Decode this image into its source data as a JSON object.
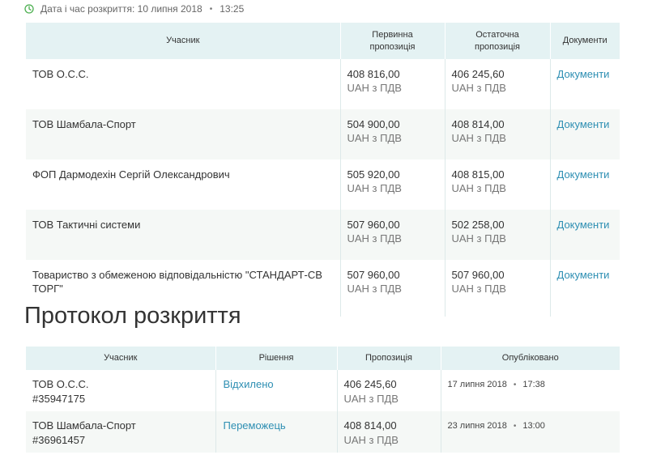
{
  "opening": {
    "label": "Дата і час розкриття: 10 липня 2018",
    "separator": "•",
    "time": "13:25"
  },
  "bids": {
    "headers": {
      "participant": "Учасник",
      "initial_line1": "Первинна",
      "initial_line2": "пропозиція",
      "final_line1": "Остаточна",
      "final_line2": "пропозиція",
      "documents": "Документи"
    },
    "rows": [
      {
        "name": "ТОВ О.С.С.",
        "initial": "408 816,00",
        "initial_unit": "UAH з ПДВ",
        "final": "406 245,60",
        "final_unit": "UAH з ПДВ",
        "docs": "Документи"
      },
      {
        "name": "ТОВ Шамбала-Спорт",
        "initial": "504 900,00",
        "initial_unit": "UAH з ПДВ",
        "final": "408 814,00",
        "final_unit": "UAH з ПДВ",
        "docs": "Документи"
      },
      {
        "name": "ФОП Дармодехін Сергій Олександрович",
        "initial": "505 920,00",
        "initial_unit": "UAH з ПДВ",
        "final": "408 815,00",
        "final_unit": "UAH з ПДВ",
        "docs": "Документи"
      },
      {
        "name": "ТОВ Тактичні системи",
        "initial": "507 960,00",
        "initial_unit": "UAH з ПДВ",
        "final": "502 258,00",
        "final_unit": "UAH з ПДВ",
        "docs": "Документи"
      },
      {
        "name": "Товариство з обмеженою відповідальністю \"СТАНДАРТ-СВ ТОРГ\"",
        "initial": "507 960,00",
        "initial_unit": "UAH з ПДВ",
        "final": "507 960,00",
        "final_unit": "UAH з ПДВ",
        "docs": "Документи"
      }
    ]
  },
  "protocol": {
    "title": "Протокол розкриття",
    "headers": {
      "participant": "Учасник",
      "decision": "Рішення",
      "offer": "Пропозиція",
      "published": "Опубліковано"
    },
    "rows": [
      {
        "name": "ТОВ О.С.С.",
        "id": "#35947175",
        "decision": "Відхилено",
        "offer": "406 245,60",
        "offer_unit": "UAH з ПДВ",
        "date": "17 липня 2018",
        "separator": "•",
        "time": "17:38"
      },
      {
        "name": "ТОВ Шамбала-Спорт",
        "id": "#36961457",
        "decision": "Переможець",
        "offer": "408 814,00",
        "offer_unit": "UAH з ПДВ",
        "date": "23 липня 2018",
        "separator": "•",
        "time": "13:00"
      }
    ]
  },
  "colors": {
    "header_bg": "#e4f2f3",
    "link": "#2e8fb3",
    "clock_icon": "#4caf50"
  }
}
